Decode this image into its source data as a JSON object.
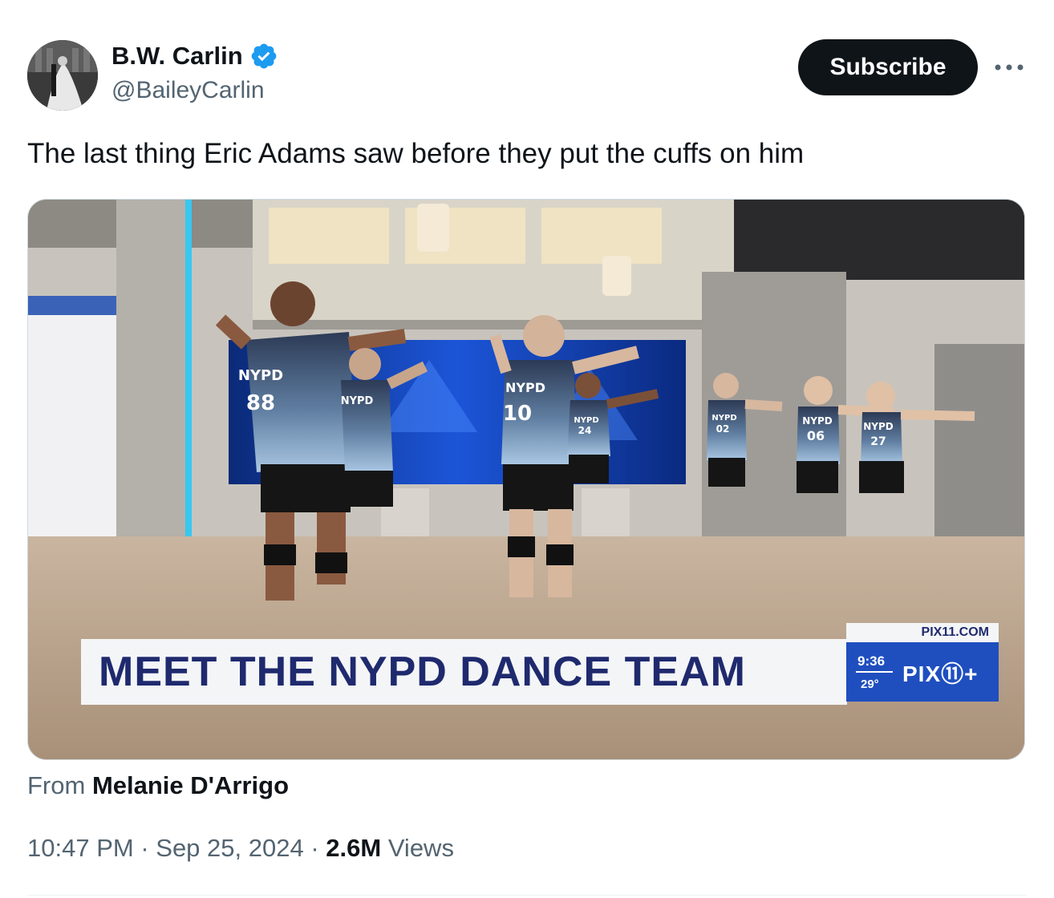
{
  "author": {
    "display_name": "B.W. Carlin",
    "handle": "@BaileyCarlin",
    "verified_icon": "verified-badge-icon",
    "verified_color": "#1d9bf0"
  },
  "actions": {
    "subscribe_label": "Subscribe",
    "more_icon": "more-horizontal-icon"
  },
  "tweet": {
    "text": "The last thing Eric Adams saw before they put the cuffs on him"
  },
  "media": {
    "lower_third": "MEET THE NYPD DANCE TEAM",
    "station_url": "PIX11.COM",
    "time": "9:36",
    "temperature": "29°",
    "station_logo": "PIX⑪+",
    "brand_color": "#1f4fbf",
    "headline_color": "#1f2a6e",
    "jerseys": [
      {
        "label": "NYPD",
        "number": "88"
      },
      {
        "label": "NYPD",
        "number": ""
      },
      {
        "label": "NYPD",
        "number": "10"
      },
      {
        "label": "NYPD",
        "number": "24"
      },
      {
        "label": "NYPD",
        "number": "02"
      },
      {
        "label": "NYPD",
        "number": "06"
      },
      {
        "label": "NYPD",
        "number": "27"
      }
    ]
  },
  "attribution": {
    "prefix": "From",
    "source": "Melanie D'Arrigo"
  },
  "meta": {
    "time": "10:47 PM",
    "sep1": " · ",
    "date": "Sep 25, 2024",
    "sep2": " · ",
    "views_count": "2.6M",
    "views_label": " Views"
  }
}
